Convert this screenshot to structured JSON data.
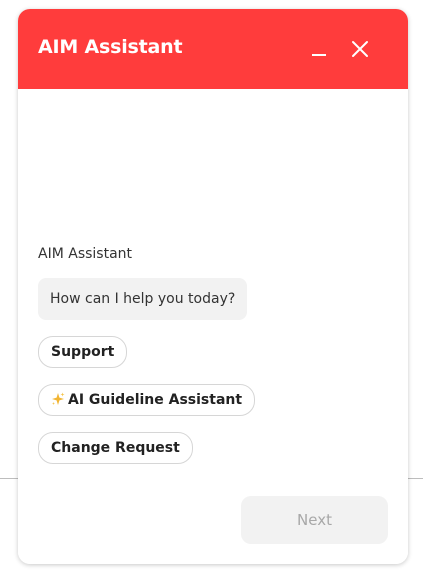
{
  "header": {
    "title": "AIM Assistant",
    "background_color": "#ff3c3c",
    "minimize_icon": "minimize-icon",
    "close_icon": "close-icon"
  },
  "chat": {
    "sender_name": "AIM Assistant",
    "message": "How can I help you today?",
    "options": [
      {
        "label": "Support"
      },
      {
        "label": "AI Guideline Assistant",
        "icon": "sparkle-icon"
      },
      {
        "label": "Change Request"
      }
    ]
  },
  "footer": {
    "next_label": "Next",
    "next_disabled": true
  }
}
